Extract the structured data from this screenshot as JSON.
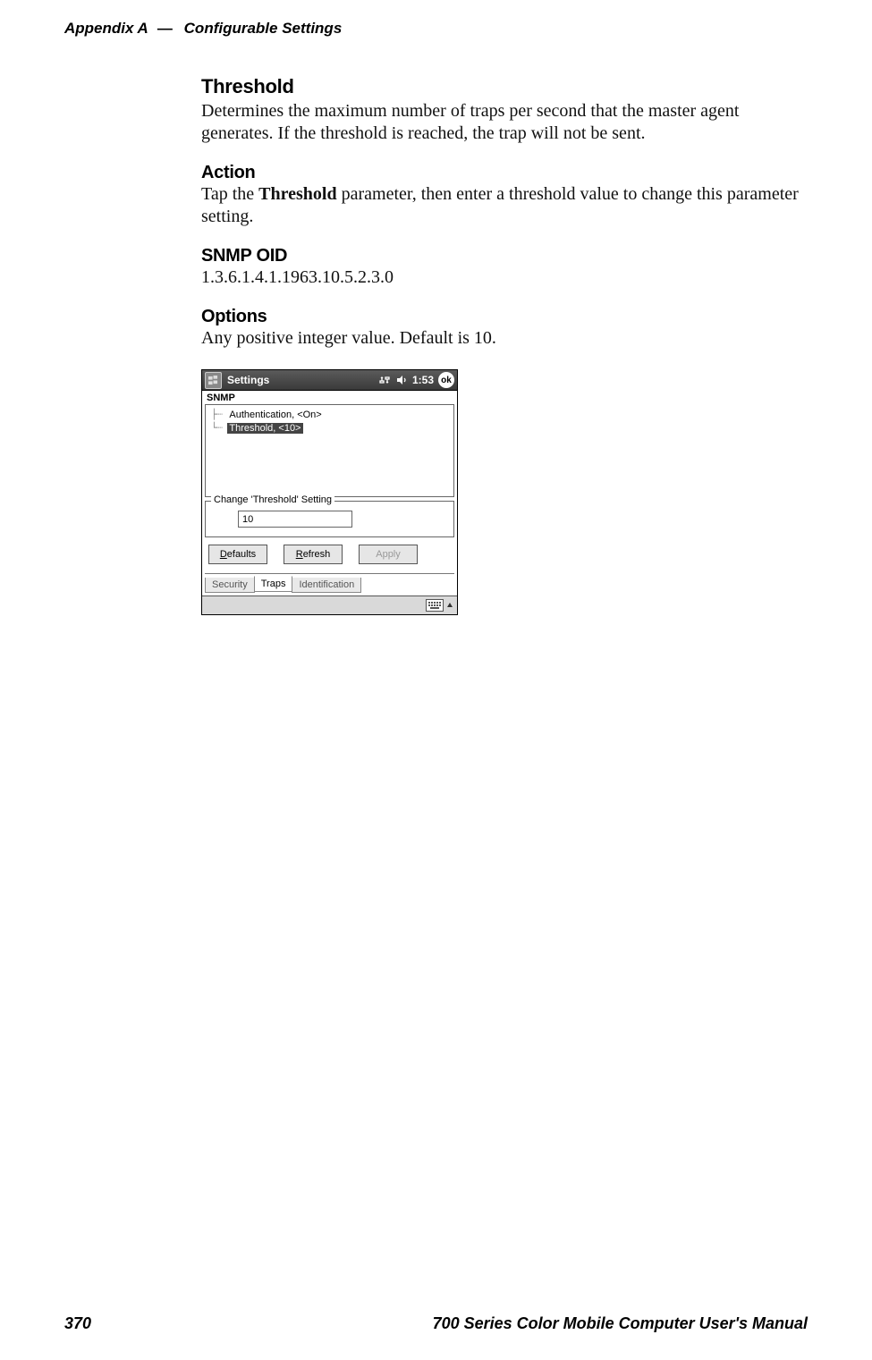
{
  "header": {
    "appendix": "Appendix A",
    "dash": "—",
    "title": "Configurable Settings"
  },
  "sections": {
    "threshold": {
      "heading": "Threshold",
      "body": "Determines the maximum number of traps per second that the master agent generates. If the threshold is reached, the trap will not be sent."
    },
    "action": {
      "heading": "Action",
      "body_pre": "Tap the ",
      "body_bold": "Threshold",
      "body_post": " parameter, then enter a threshold value to change this parameter setting."
    },
    "snmp_oid": {
      "heading": "SNMP OID",
      "body": "1.3.6.1.4.1.1963.10.5.2.3.0"
    },
    "options": {
      "heading": "Options",
      "body": "Any positive integer value. Default is 10."
    }
  },
  "screenshot": {
    "titlebar": {
      "app": "Settings",
      "time": "1:53",
      "ok": "ok"
    },
    "panel_title": "SNMP",
    "tree": {
      "item0": "Authentication, <On>",
      "item1": "Threshold, <10>"
    },
    "fieldset_legend": "Change 'Threshold' Setting",
    "input_value": "10",
    "buttons": {
      "defaults_u": "D",
      "defaults_rest": "efaults",
      "refresh_u": "R",
      "refresh_rest": "efresh",
      "apply": "Apply"
    },
    "tabs": {
      "security": "Security",
      "traps": "Traps",
      "identification": "Identification"
    }
  },
  "footer": {
    "page": "370",
    "manual": "700 Series Color Mobile Computer User's Manual"
  }
}
